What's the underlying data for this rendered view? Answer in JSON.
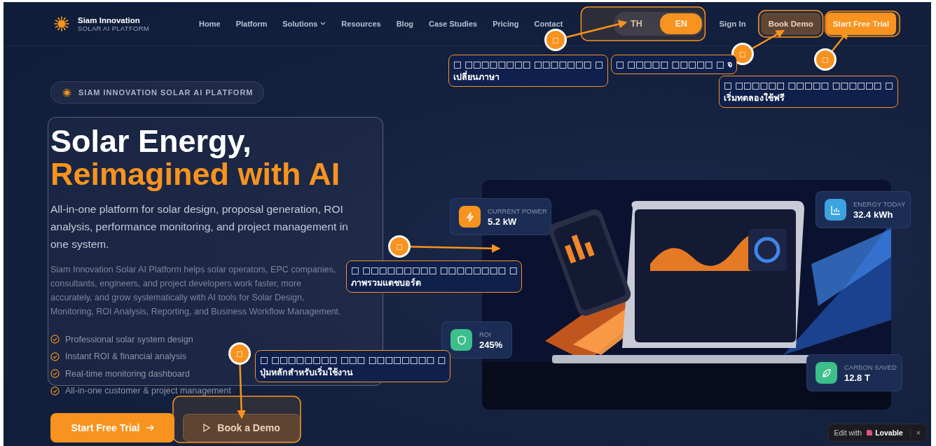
{
  "brand": {
    "name": "Siam Innovation",
    "tagline": "SOLAR AI PLATFORM"
  },
  "nav": [
    {
      "label": "Home",
      "dropdown": false
    },
    {
      "label": "Platform",
      "dropdown": false
    },
    {
      "label": "Solutions",
      "dropdown": true
    },
    {
      "label": "Resources",
      "dropdown": false
    },
    {
      "label": "Blog",
      "dropdown": false
    },
    {
      "label": "Case Studies",
      "dropdown": false
    },
    {
      "label": "Pricing",
      "dropdown": false
    },
    {
      "label": "Contact",
      "dropdown": false
    }
  ],
  "languages": [
    {
      "label": "TH",
      "selected": false
    },
    {
      "label": "EN",
      "selected": true
    }
  ],
  "header_actions": {
    "sign_in": "Sign In",
    "book_demo": "Book Demo",
    "trial": "Start Free Trial"
  },
  "hero": {
    "badge": "SIAM INNOVATION SOLAR AI PLATFORM",
    "title_line_1": "Solar Energy,",
    "title_line_2": "Reimagined with AI",
    "subtitle": "All-in-one platform for solar design, proposal generation, ROI analysis, performance monitoring, and project management in one system.",
    "description": "Siam Innovation Solar AI Platform helps solar operators, EPC companies, consultants, engineers, and project developers work faster, more accurately, and grow systematically with AI tools for Solar Design, Monitoring, ROI Analysis, Reporting, and Business Workflow Management.",
    "features": [
      "Professional solar system design",
      "Instant ROI & financial analysis",
      "Real-time monitoring dashboard",
      "All-in-one customer & project management"
    ],
    "primary_button": "Start Free Trial",
    "secondary_button": "Book a Demo"
  },
  "stats": [
    {
      "label": "CURRENT POWER",
      "value": "5.2 kW",
      "color": "#f7931e"
    },
    {
      "label": "ENERGY TODAY",
      "value": "32.4 kWh",
      "color": "#3ba3e0"
    },
    {
      "label": "ROI",
      "value": "245%",
      "color": "#3cbf8a"
    },
    {
      "label": "CARBON SAVED",
      "value": "12.8 T",
      "color": "#3cbf8a"
    }
  ],
  "annotations": [
    {
      "marker": "□",
      "lines": [
        "□ □□□□□□□□ □□□□□□□ □",
        "เปลี่ยนภาษา"
      ]
    },
    {
      "marker": "□",
      "lines": [
        "□ □□□□□ □□□□□ □ จ"
      ]
    },
    {
      "marker": "□",
      "lines": [
        "□ □□□□□□ □□□□□ □□□□□□ □",
        "เริ่มทดลองใช้ฟรี"
      ]
    },
    {
      "marker": "□",
      "lines": [
        "□ □□□□□□□□□ □□□□□□□□ □",
        "ภาพรวมแดชบอร์ด"
      ]
    },
    {
      "marker": "□",
      "lines": [
        "□ □□□□□□□□ □□□ □□□□□□□□ □",
        "ปุ่มหลักสำหรับเริ่มใช้งาน"
      ]
    }
  ],
  "editor_badge": {
    "prefix": "Edit with",
    "brand": "Lovable",
    "close": "×"
  }
}
